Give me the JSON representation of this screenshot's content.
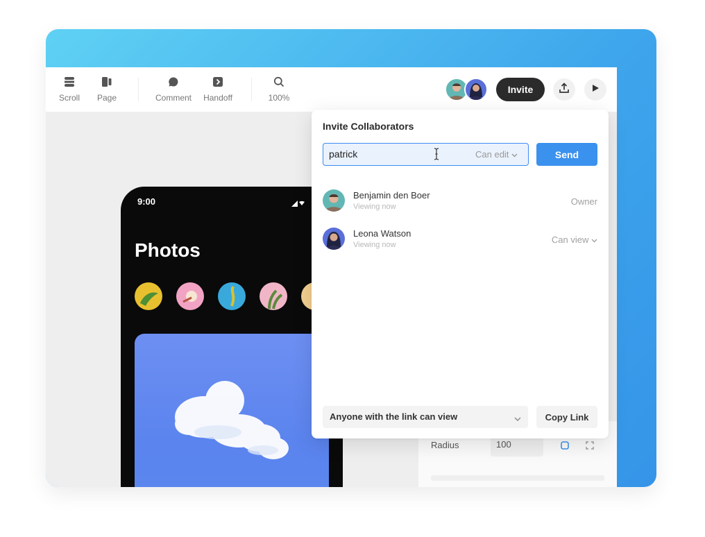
{
  "toolbar": {
    "tools": [
      {
        "label": "Scroll",
        "icon": "scroll-icon"
      },
      {
        "label": "Page",
        "icon": "page-icon"
      },
      {
        "label": "Comment",
        "icon": "comment-icon"
      },
      {
        "label": "Handoff",
        "icon": "handoff-icon"
      },
      {
        "label": "100%",
        "icon": "zoom-icon"
      }
    ],
    "invite_label": "Invite",
    "share_icon": "share-icon",
    "play_icon": "play-icon"
  },
  "invite_panel": {
    "title": "Invite Collaborators",
    "input_value": "patrick",
    "permission": "Can edit",
    "send_label": "Send",
    "collaborators": [
      {
        "name": "Benjamin den Boer",
        "status": "Viewing now",
        "role": "Owner"
      },
      {
        "name": "Leona Watson",
        "status": "Viewing now",
        "role": "Can view"
      }
    ],
    "link_access": "Anyone with the link can view",
    "copy_label": "Copy Link"
  },
  "phone": {
    "time": "9:00",
    "title": "Photos"
  },
  "properties": {
    "radius_label": "Radius",
    "radius_value": "100"
  },
  "colors": {
    "accent": "#3b91ee",
    "invite_button": "#2b2b2b",
    "background_gradient_start": "#5fd1f4",
    "background_gradient_end": "#3594e8"
  }
}
